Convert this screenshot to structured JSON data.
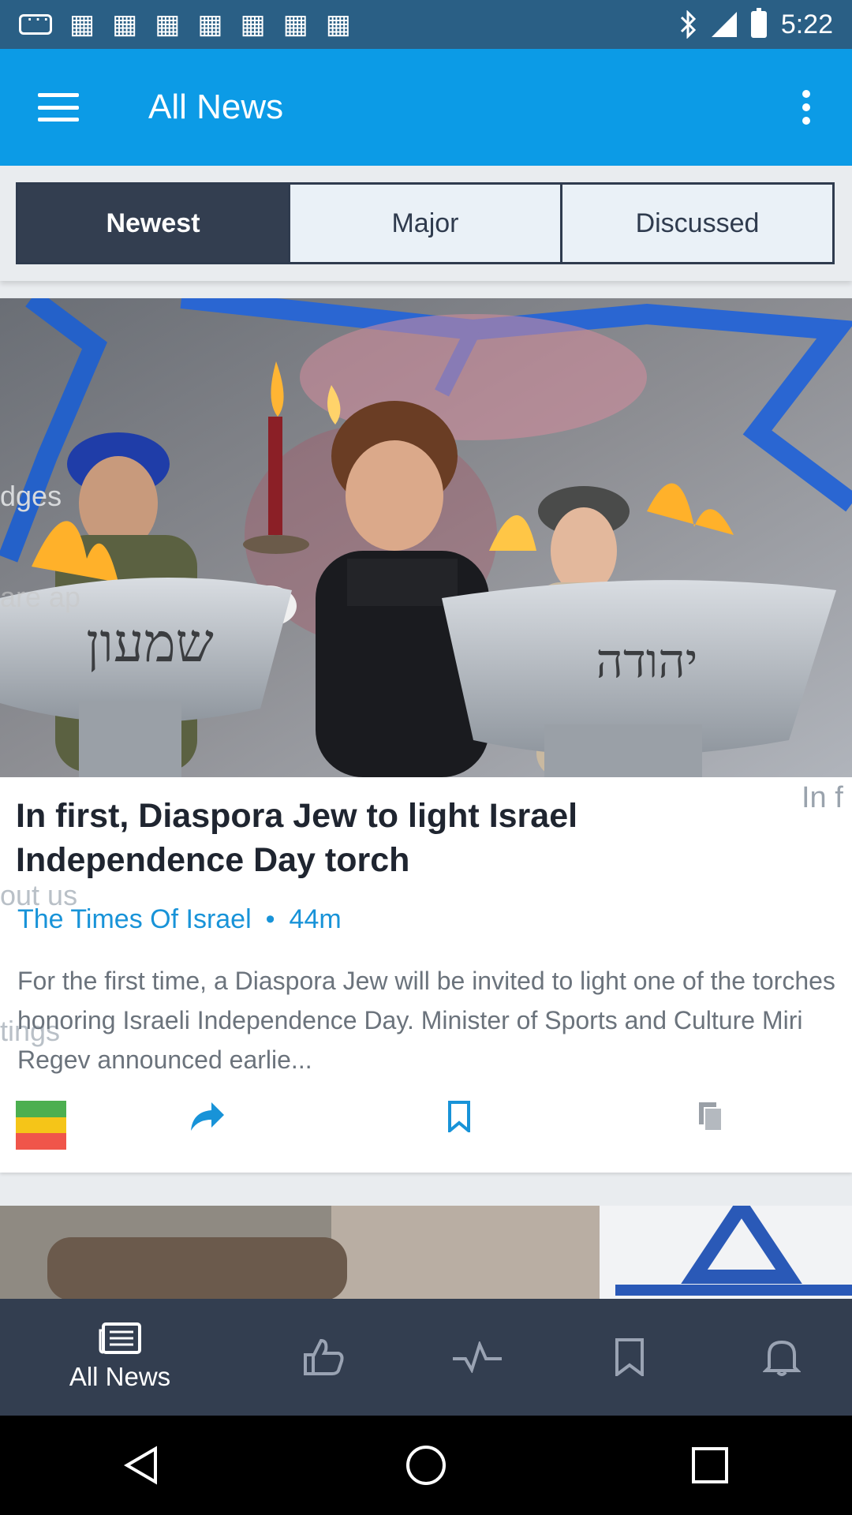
{
  "status_bar": {
    "time": "5:22",
    "icons": [
      "message-icon",
      "photo-icon",
      "photo-icon",
      "photo-icon",
      "photo-icon",
      "photo-icon",
      "photo-icon",
      "photo-icon",
      "bluetooth-icon",
      "signal-icon",
      "battery-icon"
    ]
  },
  "app_bar": {
    "title": "All News",
    "menu_icon": "hamburger-icon",
    "overflow_icon": "more-vert-icon"
  },
  "tabs": [
    {
      "label": "Newest",
      "active": true
    },
    {
      "label": "Major",
      "active": false
    },
    {
      "label": "Discussed",
      "active": false
    }
  ],
  "article": {
    "headline": "In first, Diaspora Jew to light Israel Independence Day torch",
    "source": "The Times Of Israel",
    "separator": "•",
    "age": "44m",
    "summary": "For the first time, a Diaspora Jew will be invited to light one of the torches honoring Israeli Independence Day. Minister of Sports and Culture Miri Regev announced earlie...",
    "next_peek": "In f",
    "image_text": {
      "left_sign": "שמעון",
      "right_sign": "יהודה"
    },
    "actions": [
      "sources-icon",
      "share-icon",
      "bookmark-icon",
      "copy-icon"
    ],
    "colors": {
      "bar_green": "#4caf50",
      "bar_yellow": "#f5c518",
      "bar_red": "#f0554a",
      "accent": "#1893d8"
    }
  },
  "ghost_menu": [
    "dges",
    "are ap",
    "out us",
    "tings"
  ],
  "bottom_nav": {
    "items": [
      {
        "label": "All News",
        "icon": "newspaper-icon",
        "active": true
      },
      {
        "label": "",
        "icon": "thumbs-up-icon",
        "active": false
      },
      {
        "label": "",
        "icon": "pulse-icon",
        "active": false
      },
      {
        "label": "",
        "icon": "bookmark-icon",
        "active": false
      },
      {
        "label": "",
        "icon": "bell-icon",
        "active": false
      }
    ]
  },
  "system_nav": [
    "back-icon",
    "home-icon",
    "recents-icon"
  ]
}
